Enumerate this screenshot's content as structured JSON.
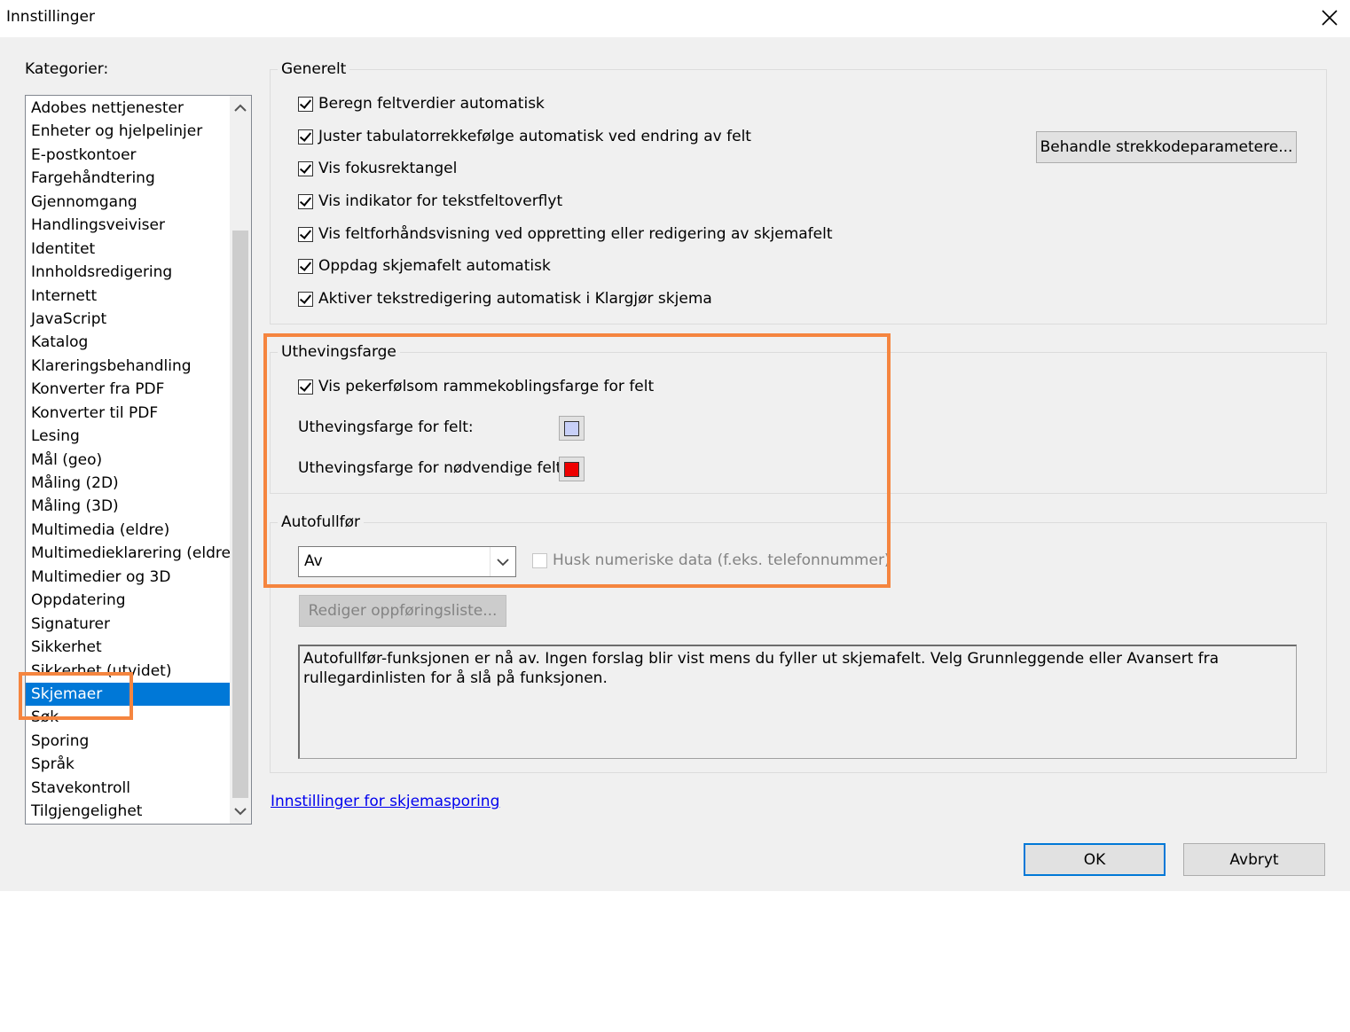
{
  "window": {
    "title": "Innstillinger",
    "close_icon": "close-icon"
  },
  "categories": {
    "label": "Kategorier:",
    "items": [
      "Adobes nettjenester",
      "Enheter og hjelpelinjer",
      "E-postkontoer",
      "Fargehåndtering",
      "Gjennomgang",
      "Handlingsveiviser",
      "Identitet",
      "Innholdsredigering",
      "Internett",
      "JavaScript",
      "Katalog",
      "Klareringsbehandling",
      "Konverter fra PDF",
      "Konverter til PDF",
      "Lesing",
      "Mål (geo)",
      "Måling (2D)",
      "Måling (3D)",
      "Multimedia (eldre)",
      "Multimedieklarering (eldre)",
      "Multimedier og 3D",
      "Oppdatering",
      "Signaturer",
      "Sikkerhet",
      "Sikkerhet (utvidet)",
      "Skjemaer",
      "Søk",
      "Sporing",
      "Språk",
      "Stavekontroll",
      "Tilgjengelighet"
    ],
    "selected": "Skjemaer"
  },
  "general": {
    "title": "Generelt",
    "checkboxes": [
      {
        "label": "Beregn feltverdier automatisk",
        "checked": true
      },
      {
        "label": "Juster tabulatorrekkefølge automatisk ved endring av felt",
        "checked": true
      },
      {
        "label": "Vis fokusrektangel",
        "checked": true
      },
      {
        "label": "Vis indikator for tekstfeltoverflyt",
        "checked": true
      },
      {
        "label": "Vis feltforhåndsvisning ved oppretting eller redigering av skjemafelt",
        "checked": true
      },
      {
        "label": "Oppdag skjemafelt automatisk",
        "checked": true
      },
      {
        "label": "Aktiver tekstredigering automatisk i Klargjør skjema",
        "checked": true
      }
    ],
    "barcode_button": "Behandle strekkodeparametere..."
  },
  "highlight": {
    "title": "Uthevingsfarge",
    "show_hover_checkbox": {
      "label": "Vis pekerfølsom rammekoblingsfarge for felt",
      "checked": true
    },
    "field_color_label": "Uthevingsfarge for felt:",
    "field_color": "#c8d0f8",
    "required_color_label": "Uthevingsfarge for nødvendige felt:",
    "required_color": "#ee0000"
  },
  "autocomplete": {
    "title": "Autofullfør",
    "select_value": "Av",
    "remember_numeric": {
      "label": "Husk numeriske data (f.eks. telefonnummer)",
      "checked": false,
      "disabled": true
    },
    "edit_list_button": "Rediger oppføringsliste...",
    "info_text": "Autofullfør-funksjonen er nå av. Ingen forslag blir vist mens du fyller ut skjemafelt. Velg Grunnleggende eller Avansert fra rullegardinlisten for å slå på funksjonen."
  },
  "tracking_link": "Innstillinger for skjemasporing",
  "footer": {
    "ok": "OK",
    "cancel": "Avbryt"
  },
  "annotation_color": "#f5853f"
}
